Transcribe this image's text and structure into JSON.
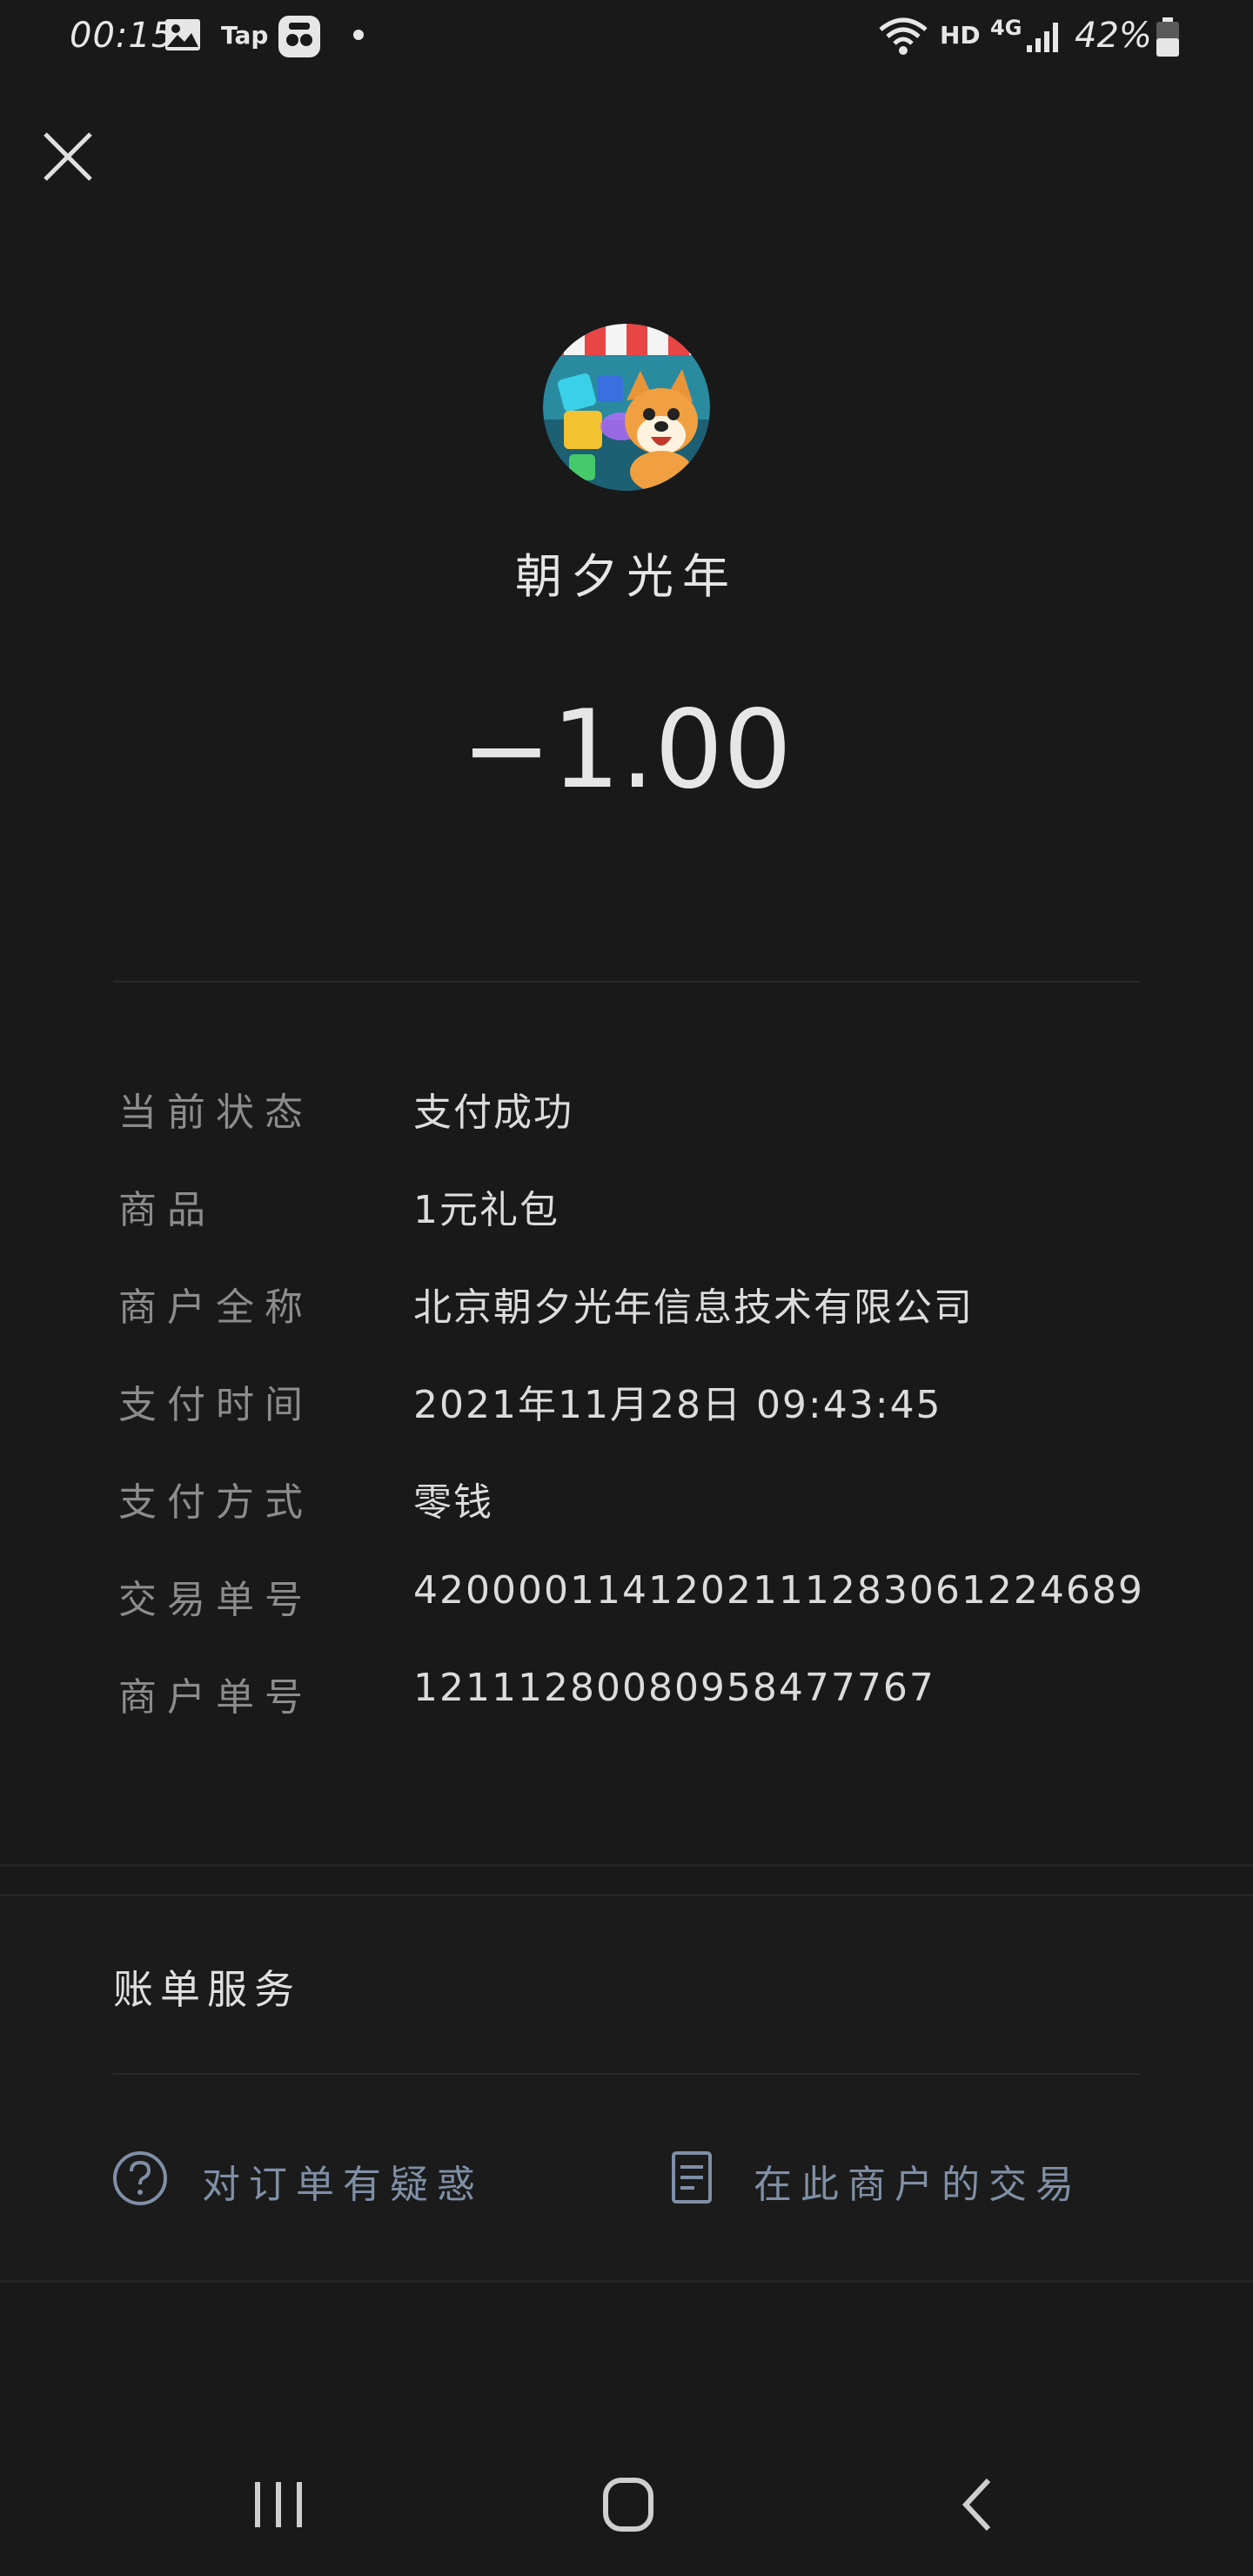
{
  "status_bar": {
    "time": "00:15",
    "app_label": "Tap",
    "network_hd": "HD",
    "network_type": "4G",
    "battery": "42%"
  },
  "merchant": {
    "name": "朝夕光年",
    "amount": "−1.00"
  },
  "details": [
    {
      "label": "当前状态",
      "value": "支付成功"
    },
    {
      "label": "商品",
      "value": "1元礼包"
    },
    {
      "label": "商户全称",
      "value": "北京朝夕光年信息技术有限公司"
    },
    {
      "label": "支付时间",
      "value": "2021年11月28日 09:43:45"
    },
    {
      "label": "支付方式",
      "value": "零钱"
    },
    {
      "label": "交易单号",
      "value": "4200001141202111283061224689"
    },
    {
      "label": "商户单号",
      "value": "1211128008095847776​7"
    }
  ],
  "bill_service": {
    "title": "账单服务",
    "question_label": "对订单有疑惑",
    "merchant_tx_label": "在此商户的交易"
  },
  "colors": {
    "background": "#191919",
    "link": "#7f8fa6"
  }
}
